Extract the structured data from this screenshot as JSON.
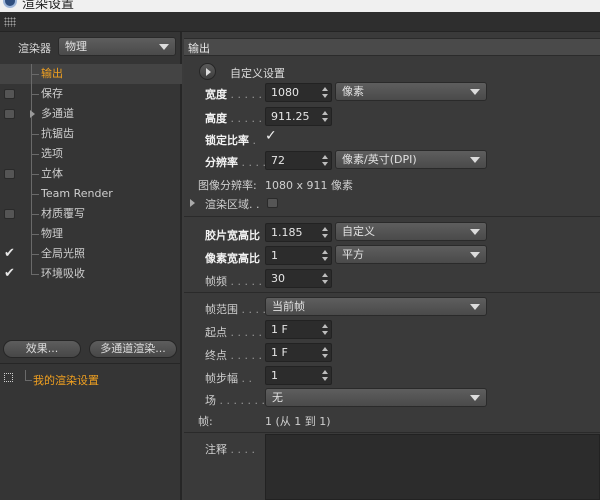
{
  "window": {
    "title": "渲染设置"
  },
  "left": {
    "renderer_label": "渲染器",
    "renderer_value": "物理",
    "items": [
      {
        "label": "输出",
        "state": "none",
        "selected": true
      },
      {
        "label": "保存",
        "state": "box"
      },
      {
        "label": "多通道",
        "state": "box",
        "expandable": true
      },
      {
        "label": "抗锯齿",
        "state": "none"
      },
      {
        "label": "选项",
        "state": "none"
      },
      {
        "label": "立体",
        "state": "box"
      },
      {
        "label": "Team Render",
        "state": "none"
      },
      {
        "label": "材质覆写",
        "state": "box"
      },
      {
        "label": "物理",
        "state": "none"
      },
      {
        "label": "全局光照",
        "state": "check"
      },
      {
        "label": "环境吸收",
        "state": "check"
      }
    ],
    "effects_button": "效果...",
    "multipass_button": "多通道渲染...",
    "my_settings": "我的渲染设置"
  },
  "right": {
    "section_title": "输出",
    "preset_label": "自定义设置",
    "width_label": "宽度",
    "width_value": "1080",
    "width_unit": "像素",
    "height_label": "高度",
    "height_value": "911.25",
    "lock_label": "锁定比率",
    "lock_checked": "✓",
    "resolution_label": "分辨率",
    "resolution_value": "72",
    "resolution_unit": "像素/英寸(DPI)",
    "image_res_label": "图像分辨率:",
    "image_res_value": "1080 x 911 像素",
    "render_region_label": "渲染区域",
    "film_aspect_label": "胶片宽高比",
    "film_aspect_value": "1.185",
    "film_aspect_preset": "自定义",
    "pixel_aspect_label": "像素宽高比",
    "pixel_aspect_value": "1",
    "pixel_aspect_preset": "平方",
    "fps_label": "帧频",
    "fps_value": "30",
    "frame_range_label": "帧范围",
    "frame_range_value": "当前帧",
    "from_label": "起点",
    "from_value": "1 F",
    "to_label": "终点",
    "to_value": "1 F",
    "frame_step_label": "帧步幅",
    "frame_step_value": "1",
    "field_label": "场",
    "field_value": "无",
    "frames_label": "帧:",
    "frames_value": "1 (从 1 到 1)",
    "notes_label": "注释",
    "dots": ". . . . ."
  },
  "colors": {
    "accent": "#f0a020",
    "panel": "#3a3a3a"
  }
}
